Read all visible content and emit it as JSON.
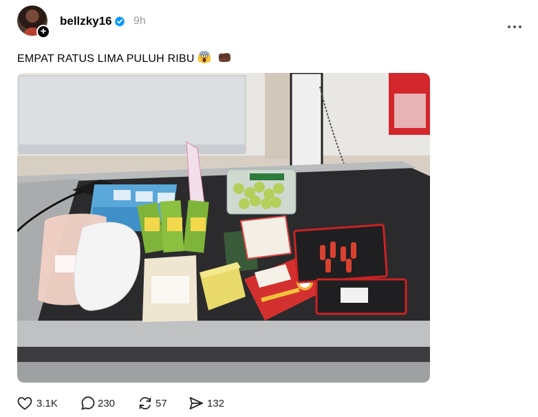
{
  "post": {
    "author": {
      "username": "bellzky16",
      "verified": true,
      "time_ago": "9h"
    },
    "caption": "EMPAT RATUS LIMA PULUH RIBU",
    "caption_emojis": [
      "screaming-face-emoji",
      "fist-bump-emoji"
    ],
    "image": {
      "alt": "Groceries on a supermarket checkout conveyor belt"
    },
    "actions": {
      "likes": "3.1K",
      "replies": "230",
      "reposts": "57",
      "shares": "132"
    }
  },
  "colors": {
    "verified_blue": "#0095f6",
    "muted_text": "#999999"
  }
}
